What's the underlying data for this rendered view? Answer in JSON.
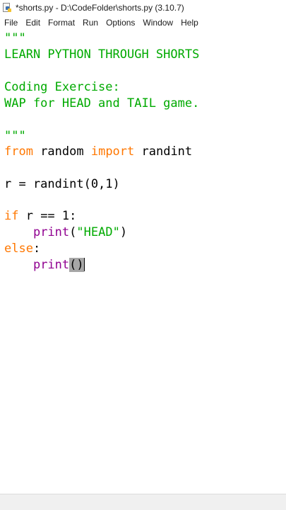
{
  "window": {
    "title": "*shorts.py - D:\\CodeFolder\\shorts.py (3.10.7)",
    "icon": "idle-python-file-icon"
  },
  "menu": [
    "File",
    "Edit",
    "Format",
    "Run",
    "Options",
    "Window",
    "Help"
  ],
  "editor": {
    "lines": [
      {
        "tokens": [
          {
            "t": "\"\"\"",
            "c": "str"
          }
        ]
      },
      {
        "tokens": [
          {
            "t": "LEARN PYTHON THROUGH SHORTS",
            "c": "str"
          }
        ]
      },
      {
        "tokens": []
      },
      {
        "tokens": [
          {
            "t": "Coding Exercise:",
            "c": "str"
          }
        ]
      },
      {
        "tokens": [
          {
            "t": "WAP for HEAD and TAIL game.",
            "c": "str"
          }
        ]
      },
      {
        "tokens": []
      },
      {
        "tokens": [
          {
            "t": "\"\"\"",
            "c": "str"
          }
        ]
      },
      {
        "tokens": [
          {
            "t": "from",
            "c": "kw"
          },
          {
            "t": " random ",
            "c": "plain"
          },
          {
            "t": "import",
            "c": "kw"
          },
          {
            "t": " randint",
            "c": "plain"
          }
        ]
      },
      {
        "tokens": []
      },
      {
        "tokens": [
          {
            "t": "r = randint(0,1)",
            "c": "plain"
          }
        ]
      },
      {
        "tokens": []
      },
      {
        "tokens": [
          {
            "t": "if",
            "c": "kw"
          },
          {
            "t": " r == 1:",
            "c": "plain"
          }
        ]
      },
      {
        "tokens": [
          {
            "t": "    ",
            "c": "plain"
          },
          {
            "t": "print",
            "c": "builtin"
          },
          {
            "t": "(",
            "c": "plain"
          },
          {
            "t": "\"HEAD\"",
            "c": "str"
          },
          {
            "t": ")",
            "c": "plain"
          }
        ]
      },
      {
        "tokens": [
          {
            "t": "else",
            "c": "kw"
          },
          {
            "t": ":",
            "c": "plain"
          }
        ]
      },
      {
        "tokens": [
          {
            "t": "    ",
            "c": "plain"
          },
          {
            "t": "print",
            "c": "builtin"
          },
          {
            "t": "()",
            "c": "hl"
          },
          {
            "t": "",
            "c": "cursor"
          }
        ]
      }
    ]
  }
}
